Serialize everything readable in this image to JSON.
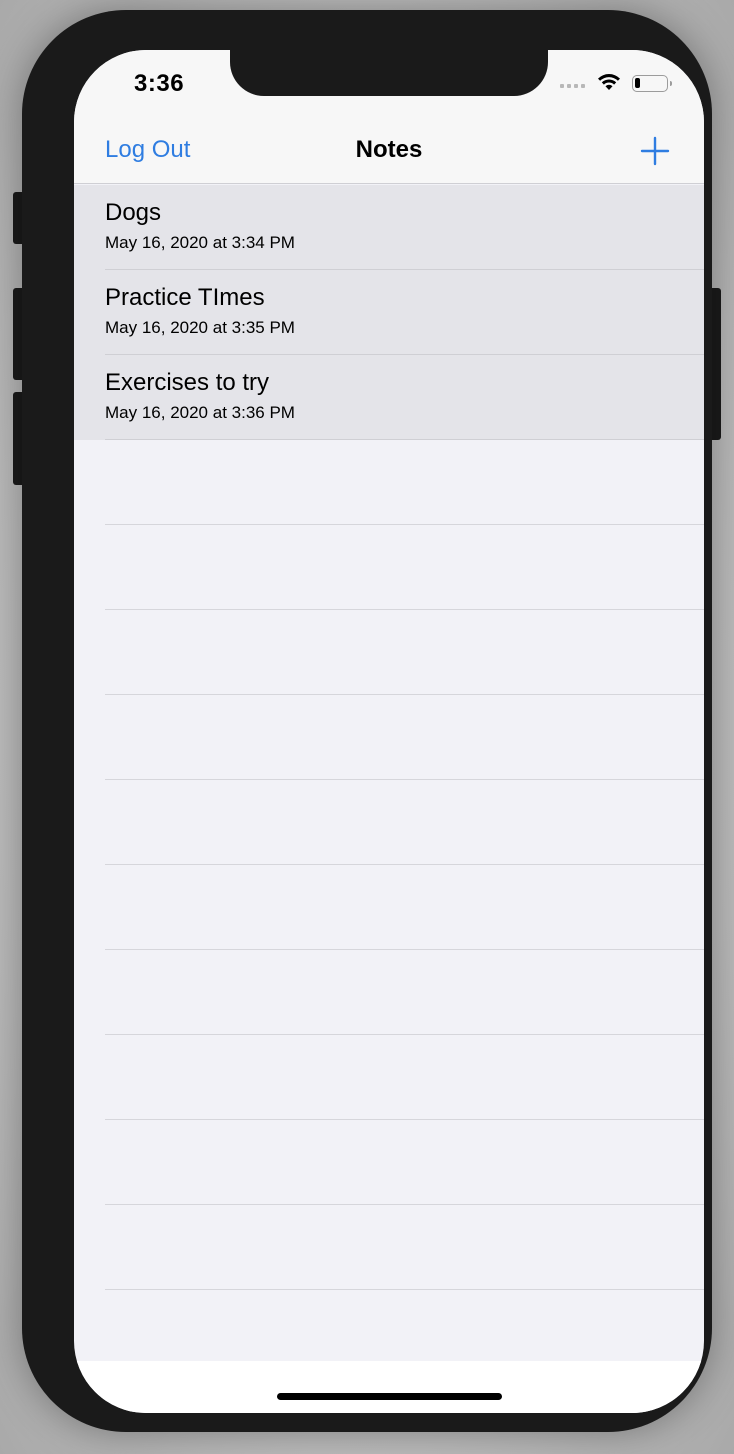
{
  "status_bar": {
    "time": "3:36"
  },
  "nav": {
    "left_button": "Log Out",
    "title": "Notes",
    "right_button_icon": "plus-icon"
  },
  "notes": [
    {
      "title": "Dogs",
      "subtitle": "May 16, 2020 at 3:34 PM"
    },
    {
      "title": "Practice TImes",
      "subtitle": "May 16, 2020 at 3:35 PM"
    },
    {
      "title": "Exercises to try",
      "subtitle": "May 16, 2020 at 3:36 PM"
    }
  ],
  "colors": {
    "accent": "#2f7de1",
    "row_background": "#e4e4e9",
    "list_background": "#f2f2f7"
  }
}
